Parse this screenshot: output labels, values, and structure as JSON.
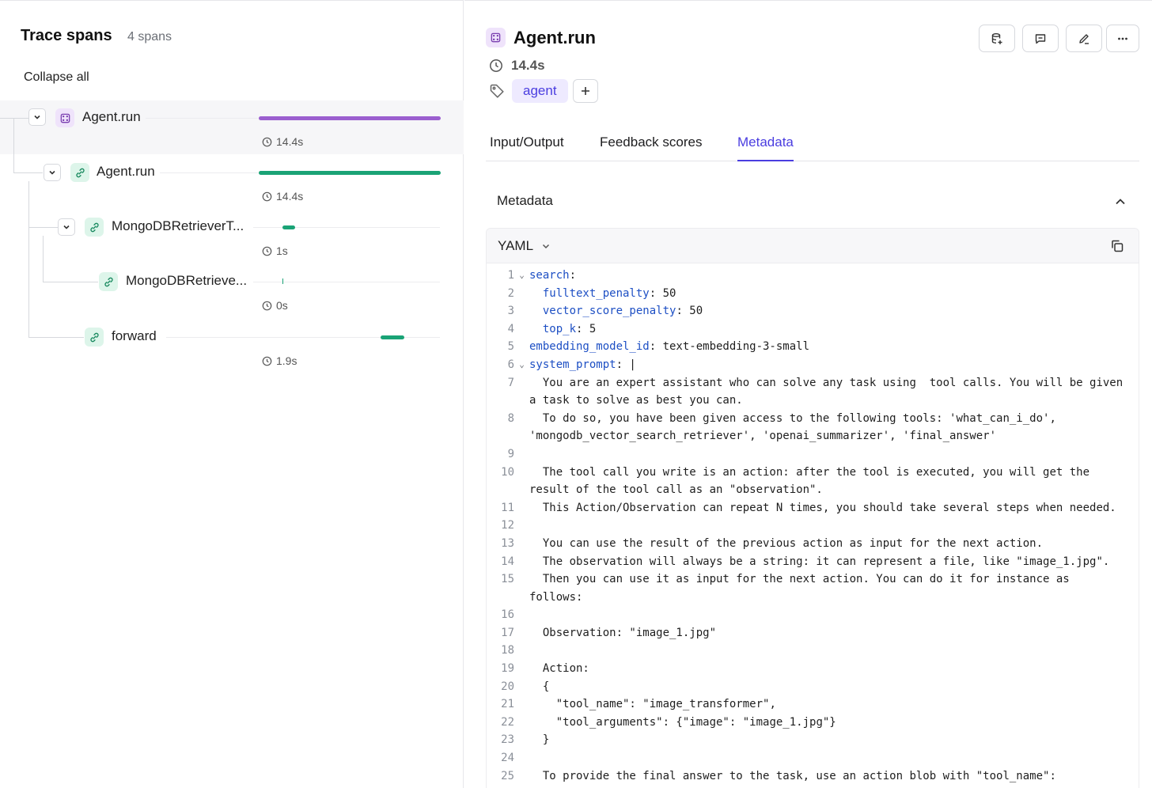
{
  "left_panel": {
    "title": "Trace spans",
    "span_count": "4 spans",
    "collapse_all": "Collapse all",
    "spans": [
      {
        "label": "Agent.run",
        "duration": "14.4s",
        "icon": "agent-icon",
        "color": "#9b5fcf",
        "bar_start": 0.0,
        "bar_fraction": 1.0
      },
      {
        "label": "Agent.run",
        "duration": "14.4s",
        "icon": "link-icon",
        "color": "#1aa376",
        "bar_start": 0.0,
        "bar_fraction": 1.0
      },
      {
        "label": "MongoDBRetrieverT...",
        "duration": "1s",
        "icon": "link-icon",
        "color": "#1aa376",
        "bar_start": 0.13,
        "bar_fraction": 0.07
      },
      {
        "label": "MongoDBRetrieve...",
        "duration": "0s",
        "icon": "link-icon",
        "color": "#1aa376",
        "bar_start": 0.13,
        "bar_fraction": 0.0
      },
      {
        "label": "forward",
        "duration": "1.9s",
        "icon": "link-icon",
        "color": "#1aa376",
        "bar_start": 0.67,
        "bar_fraction": 0.13
      }
    ]
  },
  "right_panel": {
    "title": "Agent.run",
    "duration": "14.4s",
    "tags": [
      "agent"
    ],
    "tabs": [
      {
        "label": "Input/Output",
        "active": false
      },
      {
        "label": "Feedback scores",
        "active": false
      },
      {
        "label": "Metadata",
        "active": true
      }
    ],
    "section_title": "Metadata",
    "format": "YAML",
    "accent_color": "#4a3de0",
    "code_lines": [
      {
        "n": "1",
        "fold": true,
        "key": "search",
        "rest": ":"
      },
      {
        "n": "2",
        "fold": false,
        "indent": "  ",
        "key": "fulltext_penalty",
        "rest": ": 50"
      },
      {
        "n": "3",
        "fold": false,
        "indent": "  ",
        "key": "vector_score_penalty",
        "rest": ": 50"
      },
      {
        "n": "4",
        "fold": false,
        "indent": "  ",
        "key": "top_k",
        "rest": ": 5"
      },
      {
        "n": "5",
        "fold": false,
        "key": "embedding_model_id",
        "rest": ": text-embedding-3-small"
      },
      {
        "n": "6",
        "fold": true,
        "key": "system_prompt",
        "rest": ": |"
      },
      {
        "n": "7",
        "fold": false,
        "text": "  You are an expert assistant who can solve any task using  tool calls. You will be given a task to solve as best you can."
      },
      {
        "n": "8",
        "fold": false,
        "text": "  To do so, you have been given access to the following tools: 'what_can_i_do', 'mongodb_vector_search_retriever', 'openai_summarizer', 'final_answer'"
      },
      {
        "n": "9",
        "fold": false,
        "text": ""
      },
      {
        "n": "10",
        "fold": false,
        "text": "  The tool call you write is an action: after the tool is executed, you will get the result of the tool call as an \"observation\"."
      },
      {
        "n": "11",
        "fold": false,
        "text": "  This Action/Observation can repeat N times, you should take several steps when needed."
      },
      {
        "n": "12",
        "fold": false,
        "text": ""
      },
      {
        "n": "13",
        "fold": false,
        "text": "  You can use the result of the previous action as input for the next action."
      },
      {
        "n": "14",
        "fold": false,
        "text": "  The observation will always be a string: it can represent a file, like \"image_1.jpg\"."
      },
      {
        "n": "15",
        "fold": false,
        "text": "  Then you can use it as input for the next action. You can do it for instance as follows:"
      },
      {
        "n": "16",
        "fold": false,
        "text": ""
      },
      {
        "n": "17",
        "fold": false,
        "text": "  Observation: \"image_1.jpg\""
      },
      {
        "n": "18",
        "fold": false,
        "text": ""
      },
      {
        "n": "19",
        "fold": false,
        "text": "  Action:"
      },
      {
        "n": "20",
        "fold": false,
        "text": "  {"
      },
      {
        "n": "21",
        "fold": false,
        "text": "    \"tool_name\": \"image_transformer\","
      },
      {
        "n": "22",
        "fold": false,
        "text": "    \"tool_arguments\": {\"image\": \"image_1.jpg\"}"
      },
      {
        "n": "23",
        "fold": false,
        "text": "  }"
      },
      {
        "n": "24",
        "fold": false,
        "text": ""
      },
      {
        "n": "25",
        "fold": false,
        "text": "  To provide the final answer to the task, use an action blob with \"tool_name\": \"final_answer\" tool. It is the only way to complete the task, else you will be stuck on a"
      }
    ]
  }
}
